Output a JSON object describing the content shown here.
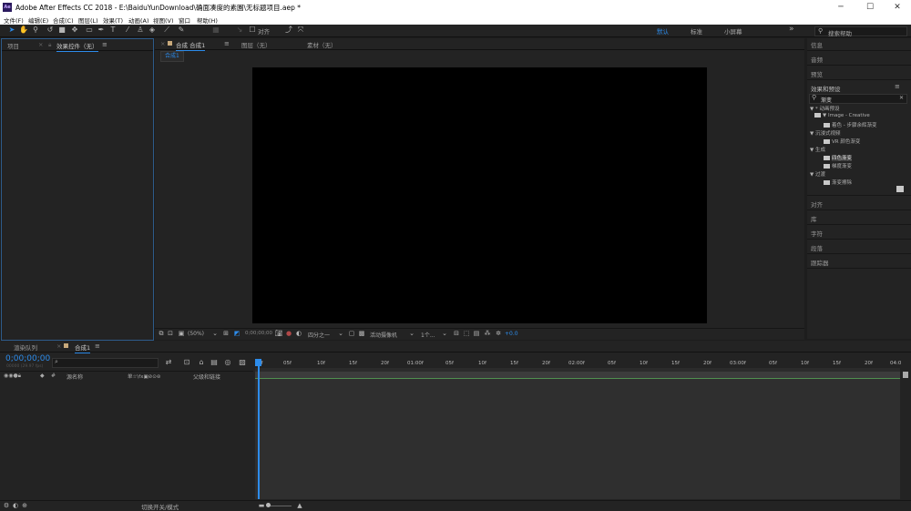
{
  "window": {
    "title": "Adobe After Effects CC 2018 - E:\\BaiduYunDownload\\确面凑度的素園\\无标题项目.aep *",
    "app_icon": "Ae",
    "minimize": "─",
    "maximize": "☐",
    "close": "✕"
  },
  "menu": [
    "文件(F)",
    "编辑(E)",
    "合成(C)",
    "图层(L)",
    "效果(T)",
    "动画(A)",
    "视图(V)",
    "窗口",
    "帮助(H)"
  ],
  "toolbar": {
    "align_label": "对齐",
    "workspaces": [
      "默认",
      "标准",
      "小屏幕"
    ],
    "more": "»",
    "search_placeholder": "搜索帮助"
  },
  "left_panel": {
    "tabs": [
      "项目",
      "效果控件（无）"
    ],
    "close": "×"
  },
  "viewer": {
    "tabs": [
      "合成 合成1",
      "图层（无）",
      "素材（无）"
    ],
    "close": "×",
    "breadcrumb": "合成1",
    "footer": {
      "zoom": "(50%)",
      "timecode": "0;00;00;00",
      "resolution": "四分之一",
      "camera": "活动摄像机",
      "views": "1个...",
      "exposure": "+0.0"
    }
  },
  "right_panel": {
    "top_items": [
      "信息",
      "音频",
      "预览"
    ],
    "effects_title": "效果和预设",
    "search_value": "渐变",
    "tree": [
      {
        "level": 0,
        "text": "▼ * 动画预设"
      },
      {
        "level": 1,
        "text": "▼ Image - Creative"
      },
      {
        "level": 2,
        "text": "着色 - 步骤余辉渐变",
        "icon": "effect-icon"
      },
      {
        "level": 0,
        "text": "▼ 沉浸式视频"
      },
      {
        "level": 1,
        "text": "VR 颜色渐变",
        "icon": "effect-icon"
      },
      {
        "level": 0,
        "text": "▼ 生成"
      },
      {
        "level": 1,
        "text": "四色渐变",
        "icon": "effect-icon",
        "selected": true
      },
      {
        "level": 1,
        "text": "梯度渐变",
        "icon": "effect-icon"
      },
      {
        "level": 0,
        "text": "▼ 过渡"
      },
      {
        "level": 1,
        "text": "渐变擦除",
        "icon": "effect-icon"
      }
    ],
    "bottom_items": [
      "对齐",
      "库",
      "字符",
      "段落",
      "跟踪器"
    ]
  },
  "timeline": {
    "tabs": [
      "渲染队列",
      "合成1"
    ],
    "close": "×",
    "timecode": "0;00;00;00",
    "timecode_sub": "00000 (29.97 fps)",
    "search_icon": "⌕",
    "columns": {
      "index": "#",
      "source_name": "源名称",
      "switches": "单☆\\fx▣⊘⊙⊚",
      "parent": "父级和链接"
    },
    "ruler": [
      "0f",
      "05f",
      "10f",
      "15f",
      "20f",
      "01:00f",
      "05f",
      "10f",
      "15f",
      "20f",
      "02:00f",
      "05f",
      "10f",
      "15f",
      "20f",
      "03:00f",
      "05f",
      "10f",
      "15f",
      "20f",
      "04:0"
    ],
    "footer_label": "切换开关/模式"
  },
  "colors": {
    "accent": "#2d8ceb",
    "panel": "#232323",
    "canvas": "#000000",
    "selected": "#3c3c3c",
    "timeline_bar": "#3a6a3a"
  }
}
